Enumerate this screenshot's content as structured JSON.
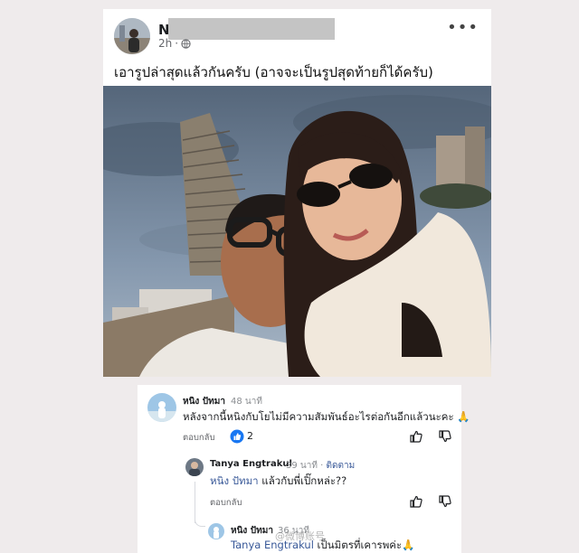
{
  "post": {
    "author_initial": "N",
    "time": "2h",
    "more": "•••",
    "caption": "เอารูปล่าสุดแล้วกันครับ (อาจจะเป็นรูปสุดท้ายก็ได้ครับ)"
  },
  "comments": [
    {
      "author": "หนิง ปัทมา",
      "time": "48 นาที",
      "text": "หลังจากนี้หนิงกับโยไม่มีความสัมพันธ์อะไรต่อกันอีกแล้วนะคะ 🙏",
      "reply_label": "ตอบกลับ",
      "like_count": "2"
    },
    {
      "author": "Tanya Engtrakul",
      "time": "39 นาที",
      "follow": "ติดตาม",
      "mention": "หนิง ปัทมา",
      "text": " แล้วกับพี่เปิ๊กหล่ะ??",
      "reply_label": "ตอบกลับ"
    },
    {
      "author": "หนิง ปัทมา",
      "time": "36 นาที",
      "mention": "Tanya Engtrakul",
      "text": " เป็นมิตรที่เคารพค่ะ🙏"
    }
  ],
  "watermark": "@微博账号",
  "colors": {
    "link": "#385898",
    "meta": "#65676b",
    "like_blue": "#1877f2"
  }
}
